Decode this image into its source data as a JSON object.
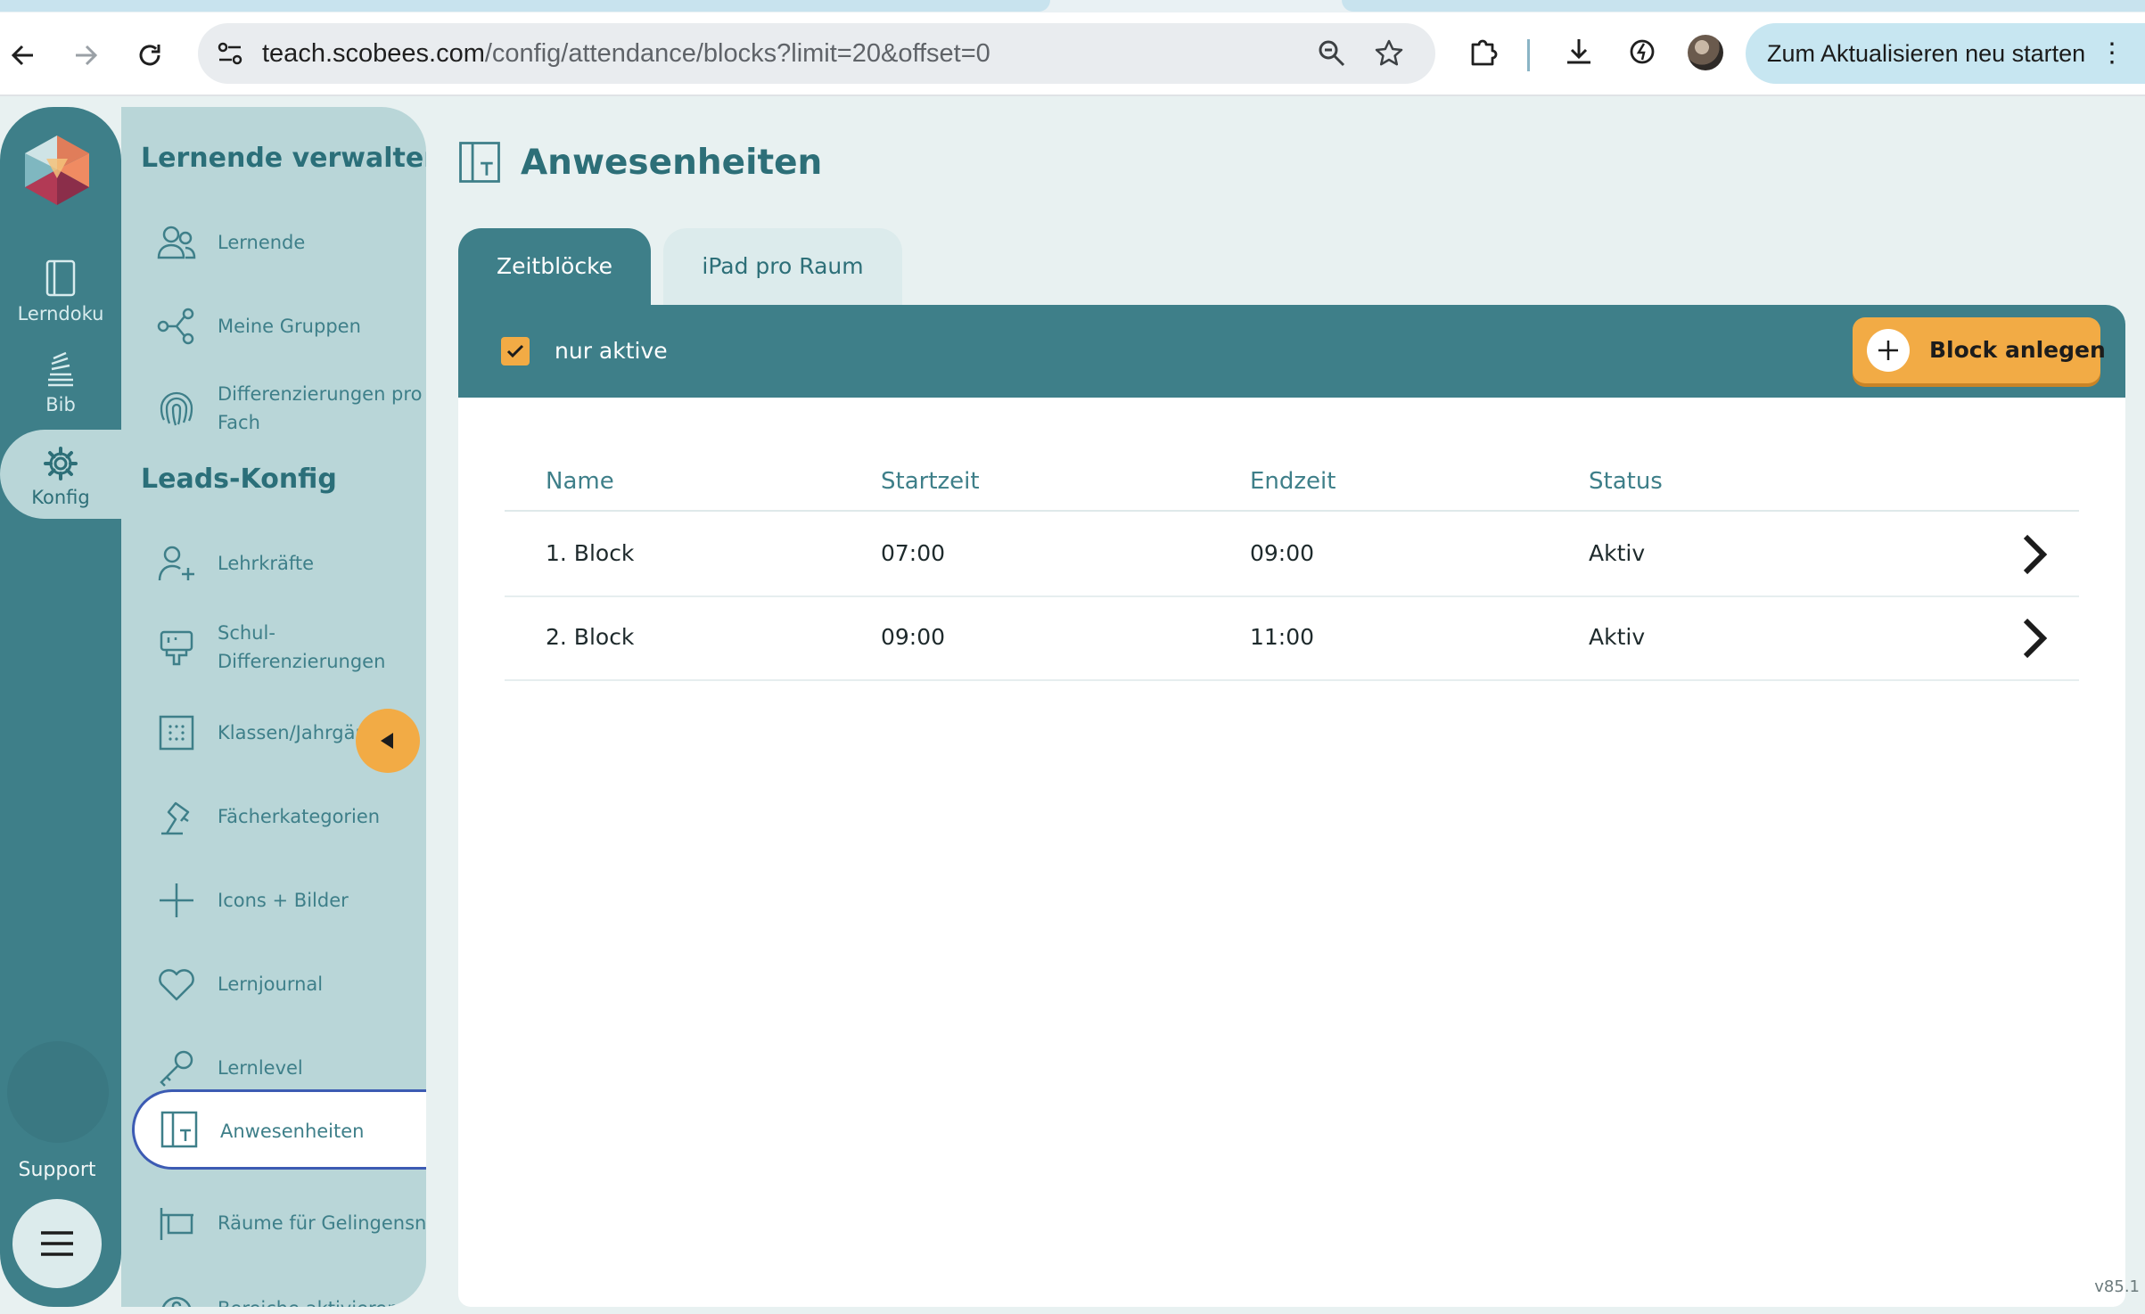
{
  "browser": {
    "url_host": "teach.scobees.com",
    "url_path": "/config/attendance/blocks?limit=20&offset=0",
    "update_label": "Zum Aktualisieren neu starten"
  },
  "rail": {
    "items": [
      {
        "label": "Lerndoku",
        "icon": "notebook-icon"
      },
      {
        "label": "Bib",
        "icon": "library-icon"
      },
      {
        "label": "Konfig",
        "icon": "gear-icon"
      }
    ],
    "support_label": "Support"
  },
  "sidebar": {
    "section1": "Lernende verwalten",
    "section2": "Leads-Konfig",
    "items": [
      {
        "label": "Lernende",
        "icon": "users-icon"
      },
      {
        "label": "Meine Gruppen",
        "icon": "share-nodes-icon"
      },
      {
        "label": "Differenzierungen pro Fach",
        "icon": "fingerprint-icon"
      },
      {
        "label": "Lehrkräfte",
        "icon": "user-plus-icon"
      },
      {
        "label": "Schul-Differenzierungen",
        "icon": "brush-icon"
      },
      {
        "label": "Klassen/Jahrgänge",
        "icon": "grid-dots-icon"
      },
      {
        "label": "Fächerkategorien",
        "icon": "lamp-icon"
      },
      {
        "label": "Icons + Bilder",
        "icon": "plus-icon"
      },
      {
        "label": "Lernjournal",
        "icon": "heart-icon"
      },
      {
        "label": "Lernlevel",
        "icon": "key-icon"
      },
      {
        "label": "Anwesenheiten",
        "icon": "door-icon"
      },
      {
        "label": "Räume für Gelingensnachweise",
        "icon": "room-icon"
      },
      {
        "label": "Bereiche aktivieren",
        "icon": "lock-icon"
      }
    ]
  },
  "main": {
    "title": "Anwesenheiten",
    "tabs": [
      {
        "label": "Zeitblöcke"
      },
      {
        "label": "iPad pro Raum"
      }
    ],
    "filter_label": "nur aktive",
    "filter_checked": true,
    "add_button": "Block anlegen",
    "columns": [
      "Name",
      "Startzeit",
      "Endzeit",
      "Status"
    ],
    "rows": [
      {
        "name": "1. Block",
        "start": "07:00",
        "end": "09:00",
        "status": "Aktiv"
      },
      {
        "name": "2. Block",
        "start": "09:00",
        "end": "11:00",
        "status": "Aktiv"
      }
    ],
    "version": "v85.1"
  },
  "colors": {
    "primary": "#3e7f89",
    "accent": "#f2ab45",
    "sidebar": "#b9d6d8",
    "background": "#e8f1f1"
  }
}
